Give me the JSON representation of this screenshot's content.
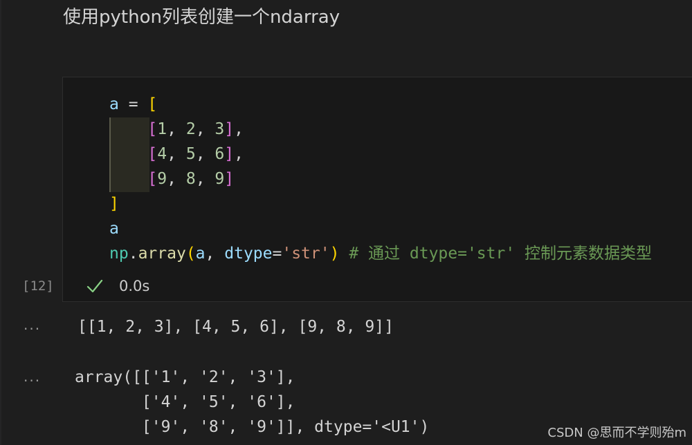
{
  "markdown": {
    "heading": "使用python列表创建一个ndarray"
  },
  "cell": {
    "execution_count": "[12]",
    "status_duration": "0.0s",
    "status_icon": "check-icon",
    "code_lines": [
      "a = [",
      "    [1, 2, 3],",
      "    [4, 5, 6],",
      "    [9, 8, 9]",
      "]",
      "a",
      "np.array(a, dtype='str') # 通过 dtype='str' 控制元素数据类型"
    ]
  },
  "outputs": [
    {
      "prompt": "...",
      "lines": [
        "[[1, 2, 3], [4, 5, 6], [9, 8, 9]]"
      ]
    },
    {
      "prompt": "...",
      "lines": [
        "array([['1', '2', '3'],",
        "       ['4', '5', '6'],",
        "       ['9', '8', '9']], dtype='<U1')"
      ]
    }
  ],
  "watermark": "CSDN @思而不学则殆m",
  "colors": {
    "background": "#1e1e1e",
    "variable": "#9cdcfe",
    "bracket_outer": "#ffd700",
    "bracket_inner": "#da70d6",
    "number": "#b5cea8",
    "function": "#dcdcaa",
    "module": "#4ec9b0",
    "string": "#ce9178",
    "comment": "#6a9955",
    "success": "#89d185"
  }
}
